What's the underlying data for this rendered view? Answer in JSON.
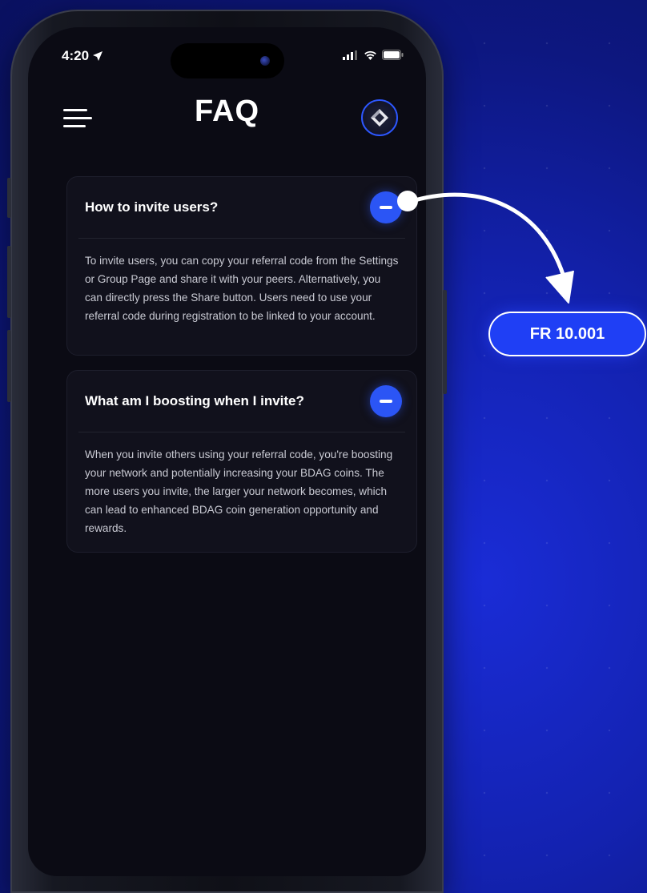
{
  "status_bar": {
    "time": "4:20"
  },
  "header": {
    "title": "FAQ"
  },
  "faq": [
    {
      "question": "How to invite users?",
      "answer": "To invite users, you can copy your referral code from the Settings or Group Page and share it with your peers. Alternatively, you can directly press the Share button. Users need to use your referral code during registration to be linked to your account."
    },
    {
      "question": "What am I boosting when I invite?",
      "answer": "When you invite others using your referral code, you're boosting your network and potentially increasing your BDAG coins. The more users you invite, the larger your network becomes, which can lead to enhanced BDAG coin generation opportunity and rewards."
    }
  ],
  "annotation": {
    "badge_label": "FR 10.001"
  },
  "colors": {
    "accent": "#2b55f5",
    "background": "#0b0b14",
    "badge": "#1f3ff5"
  }
}
